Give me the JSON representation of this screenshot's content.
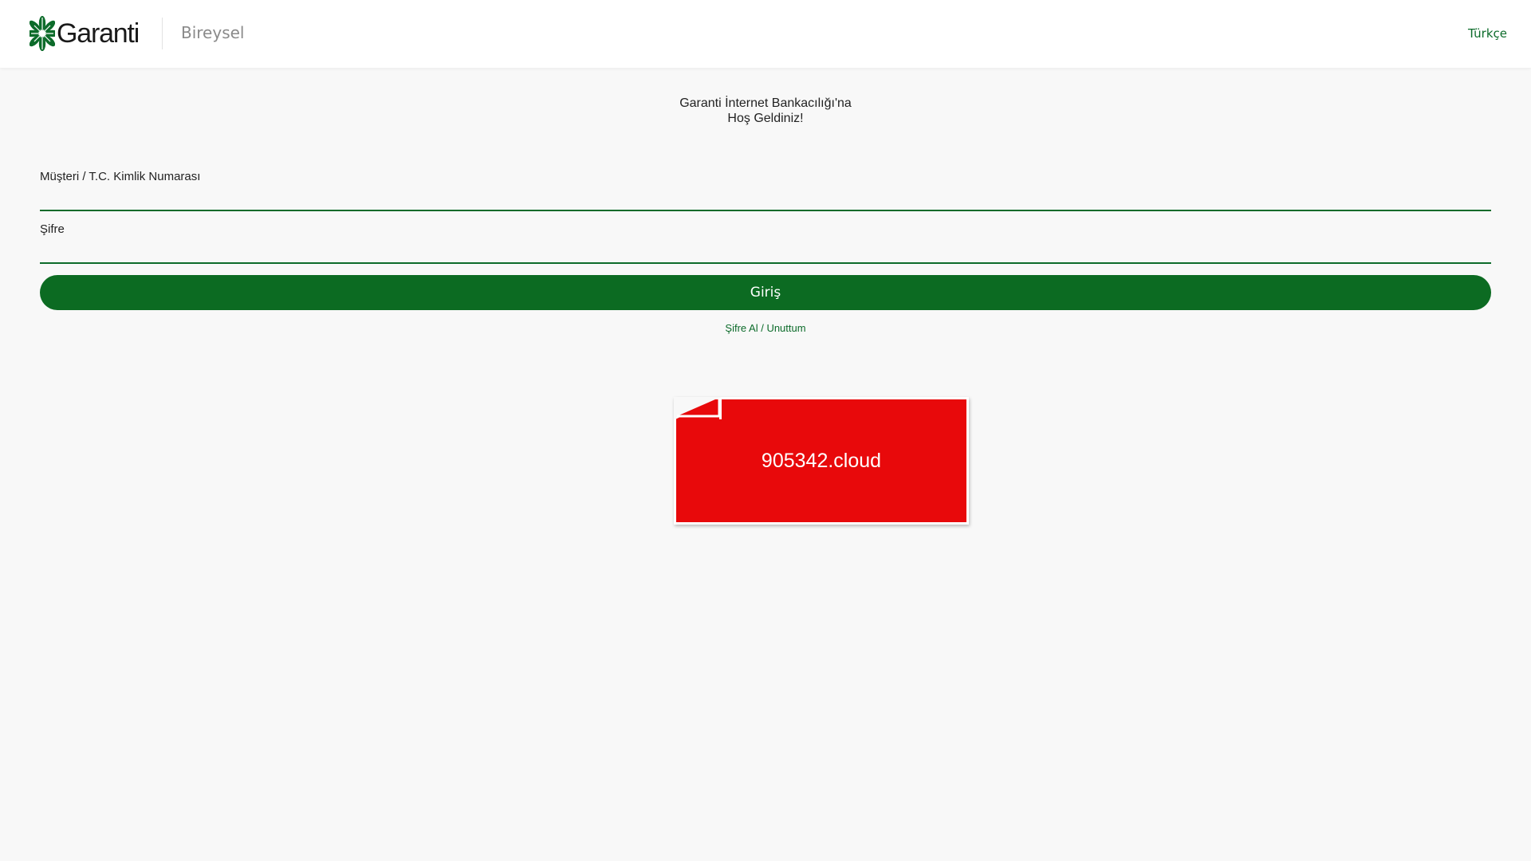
{
  "header": {
    "brand": "Garanti",
    "segment": "Bireysel",
    "language": "Türkçe"
  },
  "main": {
    "welcome_line1": "Garanti İnternet Bankacılığı'na",
    "welcome_line2": "Hoş Geldiniz!",
    "customer_field": {
      "label": "Müşteri / T.C. Kimlik Numarası",
      "value": ""
    },
    "password_field": {
      "label": "Şifre",
      "value": ""
    },
    "login_button": "Giriş",
    "forgot_link": "Şifre Al / Unuttum"
  },
  "banner": {
    "text": "905342.cloud"
  },
  "colors": {
    "brand_green": "#0c6b22",
    "banner_red": "#e8090b",
    "page_background": "#f8f8f8"
  },
  "icons": {
    "logo": "clover-leaf-logo-icon",
    "banner_fold": "page-fold-icon"
  }
}
